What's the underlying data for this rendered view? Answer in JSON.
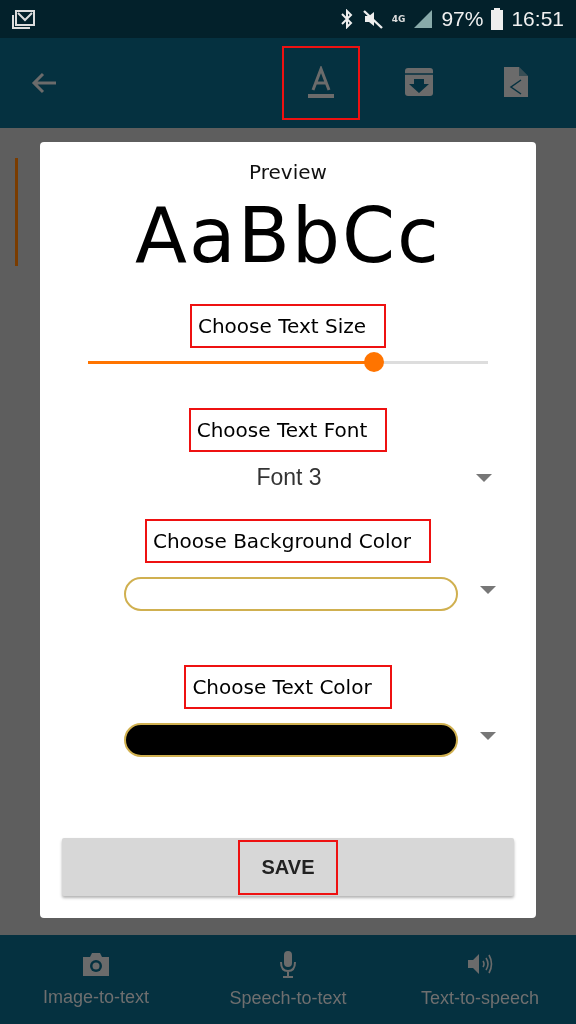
{
  "status_bar": {
    "battery": "97%",
    "time": "16:51",
    "network": "4G"
  },
  "app_bar": {
    "actions": [
      {
        "kind": "text-style",
        "highlighted": true
      },
      {
        "kind": "archive",
        "highlighted": false
      },
      {
        "kind": "share-file",
        "highlighted": false
      }
    ]
  },
  "dialog": {
    "title": "Preview",
    "sample": "AaBbCc",
    "sections": [
      {
        "kind": "slider",
        "label": "Choose Text Size",
        "highlighted": true,
        "level": 0.716
      },
      {
        "kind": "dropdown",
        "label": "Choose Text Font",
        "highlighted": true,
        "value": "Font 3"
      },
      {
        "kind": "color",
        "label": "Choose Background Color",
        "highlighted": true,
        "color": "#ffffff"
      },
      {
        "kind": "color",
        "label": "Choose Text Color",
        "highlighted": true,
        "color": "#000000"
      }
    ],
    "save": {
      "label": "SAVE",
      "highlighted": true
    }
  },
  "bottom_nav": [
    {
      "kind": "camera",
      "label": "Image-to-text"
    },
    {
      "kind": "mic",
      "label": "Speech-to-text"
    },
    {
      "kind": "speaker",
      "label": "Text-to-speech"
    }
  ]
}
